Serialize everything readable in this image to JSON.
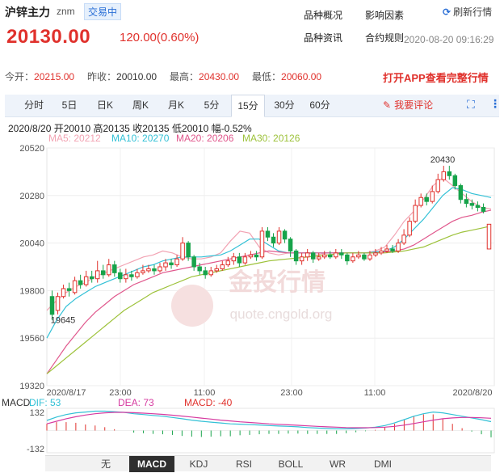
{
  "header": {
    "title": "沪锌主力",
    "code": "znm",
    "status": "交易中",
    "price": "20130.00",
    "change": "120.00(0.60%)",
    "links": [
      "品种概况",
      "影响因素",
      "品种资讯",
      "合约规则"
    ],
    "refresh_label": "刷新行情",
    "timestamp": "2020-08-20 09:16:29"
  },
  "quote": {
    "open_label": "今开：",
    "open": "20215.00",
    "prev_label": "昨收：",
    "prev": "20010.00",
    "high_label": "最高：",
    "high": "20430.00",
    "low_label": "最低：",
    "low": "20060.00",
    "app_cta": "打开APP查看完整行情"
  },
  "tabs": [
    "分时",
    "5日",
    "日K",
    "周K",
    "月K",
    "5分",
    "15分",
    "30分",
    "60分"
  ],
  "active_tab": "15分",
  "comment_label": "我要评论",
  "info": {
    "date": "2020/8/20",
    "open_label": "开",
    "open": "20010",
    "high_label": "高",
    "high": "20135",
    "close_label": "收",
    "close": "20135",
    "low_label": "低",
    "low": "20010",
    "amp_label": "幅",
    "amp": "-0.52%"
  },
  "ma": [
    {
      "label": "MA5: 20212",
      "color": "#f2a3b3"
    },
    {
      "label": "MA10: 20270",
      "color": "#33c1d6"
    },
    {
      "label": "MA20: 20206",
      "color": "#e0578c"
    },
    {
      "label": "MA30: 20126",
      "color": "#9dc23a"
    }
  ],
  "watermark": {
    "name": "金投行情",
    "url": "quote.cngold.org"
  },
  "macd": {
    "title": "MACD",
    "dif": "DIF: 53",
    "dea": "DEA: 73",
    "macd": "MACD: -40",
    "ymax": "132",
    "ymin": "-132"
  },
  "bottom_tabs": [
    "无",
    "MACD",
    "KDJ",
    "RSI",
    "BOLL",
    "WR",
    "DMI"
  ],
  "bottom_active": "MACD",
  "colors": {
    "up": "#e0312c",
    "down": "#17a34a",
    "accent": "#2a6fd6"
  },
  "chart_data": {
    "type": "candlestick",
    "interval": "15分",
    "y_ticks": [
      "20520",
      "20280",
      "20040",
      "19800",
      "19560",
      "19320"
    ],
    "ylim": [
      19320,
      20520
    ],
    "x_ticks": [
      "2020/8/17",
      "23:00",
      "11:00",
      "23:00",
      "11:00",
      "2020/8/20"
    ],
    "annotations": [
      "20430",
      "19645"
    ],
    "candles": [
      [
        19770,
        19680,
        19800,
        19650
      ],
      [
        19700,
        19770,
        19790,
        19680
      ],
      [
        19770,
        19810,
        19830,
        19760
      ],
      [
        19810,
        19800,
        19840,
        19770
      ],
      [
        19790,
        19850,
        19870,
        19780
      ],
      [
        19850,
        19830,
        19880,
        19810
      ],
      [
        19830,
        19870,
        19900,
        19820
      ],
      [
        19870,
        19860,
        19900,
        19840
      ],
      [
        19860,
        19900,
        19950,
        19840
      ],
      [
        19900,
        19880,
        19930,
        19860
      ],
      [
        19880,
        19930,
        19960,
        19870
      ],
      [
        19930,
        19890,
        19950,
        19870
      ],
      [
        19890,
        19860,
        19910,
        19840
      ],
      [
        19860,
        19880,
        19910,
        19840
      ],
      [
        19880,
        19870,
        19900,
        19850
      ],
      [
        19870,
        19890,
        19910,
        19860
      ],
      [
        19890,
        19900,
        19930,
        19880
      ],
      [
        19900,
        19910,
        19930,
        19890
      ],
      [
        19910,
        19900,
        19930,
        19880
      ],
      [
        19900,
        19920,
        19940,
        19890
      ],
      [
        19920,
        19940,
        19960,
        19900
      ],
      [
        19940,
        19930,
        19960,
        19910
      ],
      [
        19930,
        19960,
        19980,
        19920
      ],
      [
        19960,
        20040,
        20070,
        19950
      ],
      [
        20040,
        19970,
        20050,
        19950
      ],
      [
        19970,
        19920,
        19980,
        19900
      ],
      [
        19920,
        19900,
        19940,
        19880
      ],
      [
        19900,
        19880,
        19920,
        19860
      ],
      [
        19880,
        19900,
        19920,
        19870
      ],
      [
        19900,
        19910,
        19930,
        19890
      ],
      [
        19910,
        19930,
        19950,
        19900
      ],
      [
        19930,
        19950,
        19970,
        19920
      ],
      [
        19950,
        19970,
        19990,
        19930
      ],
      [
        19970,
        19940,
        19990,
        19920
      ],
      [
        19940,
        19970,
        19990,
        19930
      ],
      [
        19970,
        19980,
        20000,
        19960
      ],
      [
        19980,
        19970,
        20000,
        19950
      ],
      [
        19970,
        20100,
        20120,
        19960
      ],
      [
        20100,
        20070,
        20120,
        20050
      ],
      [
        20070,
        20040,
        20090,
        20020
      ],
      [
        20040,
        20100,
        20120,
        20030
      ],
      [
        20100,
        20060,
        20110,
        20040
      ],
      [
        20060,
        20000,
        20070,
        19970
      ],
      [
        20000,
        19950,
        20010,
        19930
      ],
      [
        19950,
        19970,
        19990,
        19930
      ],
      [
        19970,
        19990,
        20010,
        19950
      ],
      [
        19990,
        19960,
        20000,
        19940
      ],
      [
        19960,
        19970,
        19990,
        19950
      ],
      [
        19970,
        19980,
        20000,
        19960
      ],
      [
        19980,
        19970,
        20000,
        19960
      ],
      [
        19970,
        19990,
        20010,
        19960
      ],
      [
        19990,
        19980,
        20010,
        19960
      ],
      [
        19980,
        19950,
        19990,
        19930
      ],
      [
        19950,
        19970,
        19990,
        19940
      ],
      [
        19970,
        19980,
        20000,
        19960
      ],
      [
        19980,
        19960,
        19990,
        19950
      ],
      [
        19960,
        19980,
        20000,
        19950
      ],
      [
        19980,
        19990,
        20010,
        19970
      ],
      [
        19990,
        20000,
        20020,
        19980
      ],
      [
        20000,
        20010,
        20030,
        19990
      ],
      [
        20010,
        20000,
        20030,
        19990
      ],
      [
        20000,
        20040,
        20060,
        19990
      ],
      [
        20040,
        20080,
        20110,
        20030
      ],
      [
        20080,
        20150,
        20170,
        20070
      ],
      [
        20150,
        20230,
        20260,
        20140
      ],
      [
        20230,
        20270,
        20290,
        20220
      ],
      [
        20270,
        20250,
        20290,
        20230
      ],
      [
        20250,
        20300,
        20330,
        20240
      ],
      [
        20300,
        20360,
        20390,
        20290
      ],
      [
        20360,
        20400,
        20430,
        20350
      ],
      [
        20400,
        20380,
        20430,
        20360
      ],
      [
        20380,
        20330,
        20390,
        20310
      ],
      [
        20330,
        20260,
        20340,
        20240
      ],
      [
        20260,
        20240,
        20290,
        20220
      ],
      [
        20240,
        20230,
        20260,
        20210
      ],
      [
        20230,
        20220,
        20250,
        20200
      ],
      [
        20220,
        20200,
        20240,
        20190
      ],
      [
        20010,
        20135,
        20135,
        20010
      ]
    ],
    "series": [
      {
        "name": "MA5",
        "values": [
          19700,
          19750,
          19790,
          19820,
          19840,
          19870,
          19890,
          19910,
          19930,
          19950,
          19970,
          19980,
          20000,
          19990,
          19970,
          19960,
          19960,
          19970,
          19990,
          20050,
          20100,
          20090,
          20020,
          19990,
          19980,
          19990,
          19990,
          19990,
          19980,
          19990,
          19990,
          19990,
          19990,
          19990,
          20000,
          20020,
          20080,
          20150,
          20200,
          20260,
          20330,
          20370,
          20330,
          20290,
          20250,
          20220,
          20212
        ]
      },
      {
        "name": "MA10",
        "values": [
          19560,
          19650,
          19720,
          19760,
          19790,
          19820,
          19840,
          19860,
          19880,
          19900,
          19920,
          19930,
          19950,
          19960,
          19970,
          19970,
          19970,
          19975,
          19980,
          20000,
          20030,
          20060,
          20060,
          20030,
          20000,
          19990,
          19990,
          19990,
          19990,
          19990,
          19990,
          19990,
          19990,
          19990,
          19995,
          20000,
          20020,
          20060,
          20110,
          20160,
          20220,
          20280,
          20320,
          20310,
          20290,
          20280,
          20270
        ]
      },
      {
        "name": "MA20",
        "values": [
          19380,
          19450,
          19520,
          19580,
          19640,
          19690,
          19730,
          19770,
          19800,
          19830,
          19850,
          19870,
          19890,
          19900,
          19910,
          19920,
          19930,
          19940,
          19950,
          19960,
          19970,
          19980,
          19990,
          20000,
          19995,
          19990,
          19990,
          19990,
          19990,
          19990,
          19990,
          19990,
          19990,
          19990,
          19990,
          19995,
          20000,
          20010,
          20030,
          20060,
          20090,
          20120,
          20150,
          20170,
          20180,
          20195,
          20206
        ]
      },
      {
        "name": "MA30",
        "values": [
          19380,
          19420,
          19460,
          19500,
          19540,
          19580,
          19620,
          19660,
          19700,
          19730,
          19760,
          19790,
          19810,
          19830,
          19850,
          19870,
          19880,
          19890,
          19900,
          19910,
          19920,
          19930,
          19940,
          19950,
          19955,
          19960,
          19965,
          19970,
          19975,
          19980,
          19985,
          19990,
          19990,
          19990,
          19990,
          19990,
          19995,
          20000,
          20010,
          20020,
          20040,
          20060,
          20080,
          20095,
          20105,
          20115,
          20126
        ]
      }
    ],
    "macd_series": [
      {
        "name": "DIF",
        "values": [
          60,
          80,
          95,
          105,
          110,
          115,
          115,
          112,
          108,
          100,
          95,
          90,
          85,
          78,
          70,
          62,
          55,
          50,
          45,
          40,
          38,
          35,
          33,
          30,
          27,
          25,
          22,
          18,
          15,
          12,
          10,
          10,
          12,
          15,
          20,
          30,
          45,
          65,
          85,
          100,
          110,
          105,
          95,
          85,
          75,
          65,
          53
        ]
      },
      {
        "name": "DEA",
        "values": [
          40,
          55,
          70,
          82,
          92,
          100,
          105,
          108,
          108,
          106,
          103,
          100,
          96,
          91,
          86,
          80,
          74,
          68,
          62,
          57,
          52,
          48,
          44,
          40,
          37,
          34,
          31,
          28,
          25,
          22,
          20,
          18,
          17,
          17,
          18,
          20,
          25,
          32,
          42,
          52,
          62,
          70,
          75,
          78,
          78,
          76,
          73
        ]
      }
    ]
  }
}
